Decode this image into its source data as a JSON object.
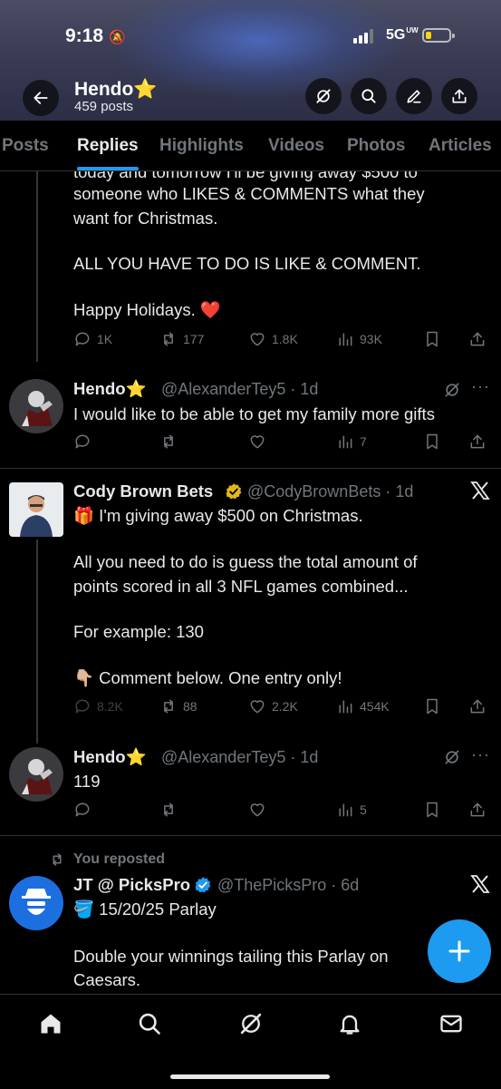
{
  "status_bar": {
    "time": "9:18",
    "network": "5G",
    "network_suffix": "UW"
  },
  "profile": {
    "name": "Hendo⭐",
    "posts_count": "459 posts"
  },
  "tabs": [
    "Posts",
    "Replies",
    "Highlights",
    "Videos",
    "Photos",
    "Articles"
  ],
  "active_tab": "Replies",
  "accent_color": "#1d9bf0",
  "posts": [
    {
      "partial": true,
      "lines": [
        "today and tomorrow I'll be giving away $500 to",
        "someone who LIKES & COMMENTS what they",
        "want for Christmas.",
        "",
        "ALL YOU HAVE TO DO IS LIKE & COMMENT.",
        "",
        "Happy Holidays. ❤️"
      ],
      "stats": {
        "replies": "1K",
        "reposts": "177",
        "likes": "1.8K",
        "views": "93K"
      }
    },
    {
      "name": "Hendo⭐",
      "handle": "@AlexanderTey5 · 1d",
      "lines": [
        "I would like to be able to get my family more gifts"
      ],
      "stats": {
        "replies": "",
        "reposts": "",
        "likes": "",
        "views": "7"
      }
    },
    {
      "name": "Cody Brown Bets",
      "verified": true,
      "handle": "@CodyBrownBets · 1d",
      "lines": [
        "🎁 I'm giving away $500 on Christmas.",
        "",
        "All you need to do is guess the total amount of",
        "points scored in all 3 NFL games combined...",
        "",
        "For example: 130",
        "",
        "👇🏼 Comment below. One entry only!"
      ],
      "stats": {
        "replies": "8.2K",
        "reposts": "88",
        "likes": "2.2K",
        "views": "454K"
      }
    },
    {
      "name": "Hendo⭐",
      "handle": "@AlexanderTey5 · 1d",
      "lines": [
        "119"
      ],
      "stats": {
        "replies": "",
        "reposts": "",
        "likes": "",
        "views": "5"
      }
    },
    {
      "repost_label": "You reposted",
      "name": "JT @ PicksPro",
      "verified": true,
      "handle": "@ThePicksPro · 6d",
      "lines": [
        "🪣 15/20/25 Parlay",
        "",
        "Double your winnings tailing this Parlay on",
        "Caesars."
      ]
    }
  ]
}
